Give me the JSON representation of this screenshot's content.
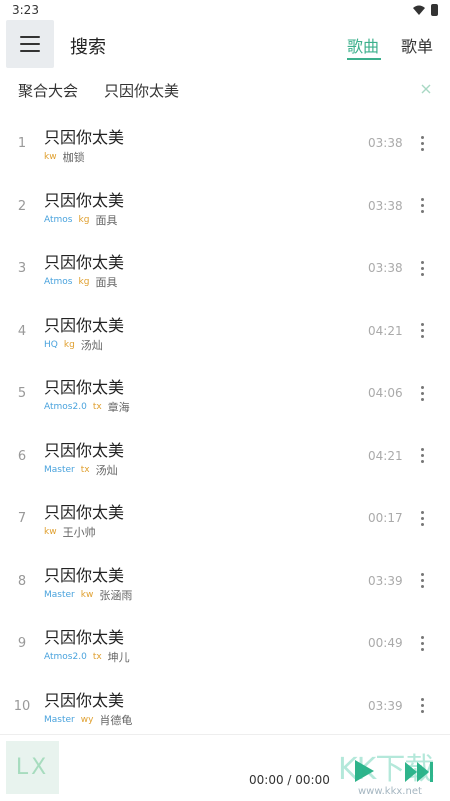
{
  "status_bar": {
    "time": "3:23"
  },
  "header": {
    "title": "搜索",
    "tabs": [
      {
        "label": "歌曲",
        "active": true
      },
      {
        "label": "歌单",
        "active": false
      }
    ]
  },
  "search": {
    "source": "聚合大会",
    "query": "只因你太美"
  },
  "songs": [
    {
      "index": "1",
      "title": "只因你太美",
      "quality": "",
      "source": "kw",
      "singer": "枷锁",
      "duration": "03:38"
    },
    {
      "index": "2",
      "title": "只因你太美",
      "quality": "Atmos",
      "source": "kg",
      "singer": "面具",
      "duration": "03:38"
    },
    {
      "index": "3",
      "title": "只因你太美",
      "quality": "Atmos",
      "source": "kg",
      "singer": "面具",
      "duration": "03:38"
    },
    {
      "index": "4",
      "title": "只因你太美",
      "quality": "HQ",
      "source": "kg",
      "singer": "汤灿",
      "duration": "04:21"
    },
    {
      "index": "5",
      "title": "只因你太美",
      "quality": "Atmos2.0",
      "source": "tx",
      "singer": "章海",
      "duration": "04:06"
    },
    {
      "index": "6",
      "title": "只因你太美",
      "quality": "Master",
      "source": "tx",
      "singer": "汤灿",
      "duration": "04:21"
    },
    {
      "index": "7",
      "title": "只因你太美",
      "quality": "",
      "source": "kw",
      "singer": "王小帅",
      "duration": "00:17"
    },
    {
      "index": "8",
      "title": "只因你太美",
      "quality": "Master",
      "source": "kw",
      "singer": "张涵雨",
      "duration": "03:39"
    },
    {
      "index": "9",
      "title": "只因你太美",
      "quality": "Atmos2.0",
      "source": "tx",
      "singer": "坤儿",
      "duration": "00:49"
    },
    {
      "index": "10",
      "title": "只因你太美",
      "quality": "Master",
      "source": "wy",
      "singer": "肖德龟",
      "duration": "03:39"
    }
  ],
  "player": {
    "cover_text": "LX",
    "time": "00:00 / 00:00"
  },
  "watermark": {
    "title": "KK下载",
    "url": "www.kkx.net"
  },
  "colors": {
    "accent": "#3cb08c",
    "quality_tag": "#4aa3dd",
    "source_tag": "#e0a030"
  }
}
